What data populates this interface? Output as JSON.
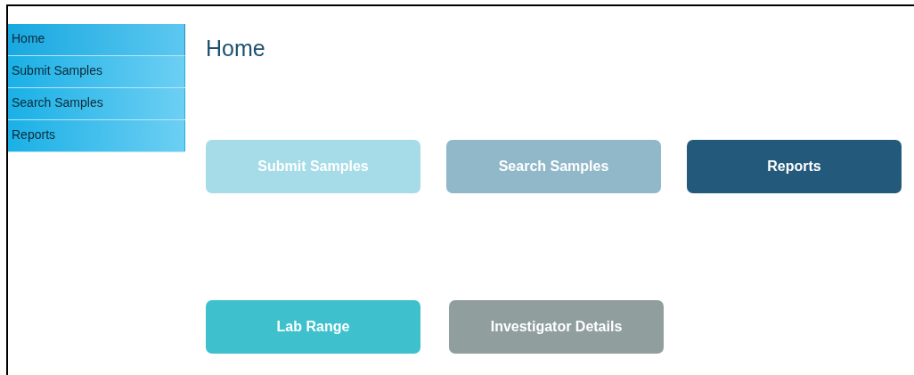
{
  "sidebar": {
    "items": [
      {
        "label": "Home",
        "selected": true
      },
      {
        "label": "Submit Samples",
        "selected": false
      },
      {
        "label": "Search Samples",
        "selected": false
      },
      {
        "label": "Reports",
        "selected": false
      }
    ]
  },
  "page_title": "Home",
  "tile_rows": [
    [
      {
        "label": "Submit Samples",
        "color": "#a6dbe8"
      },
      {
        "label": "Search Samples",
        "color": "#90b8c9"
      },
      {
        "label": "Reports",
        "color": "#235a7b"
      }
    ],
    [
      {
        "label": "Lab Range",
        "color": "#3ec1cd"
      },
      {
        "label": "Investigator Details",
        "color": "#909e9e"
      }
    ]
  ]
}
